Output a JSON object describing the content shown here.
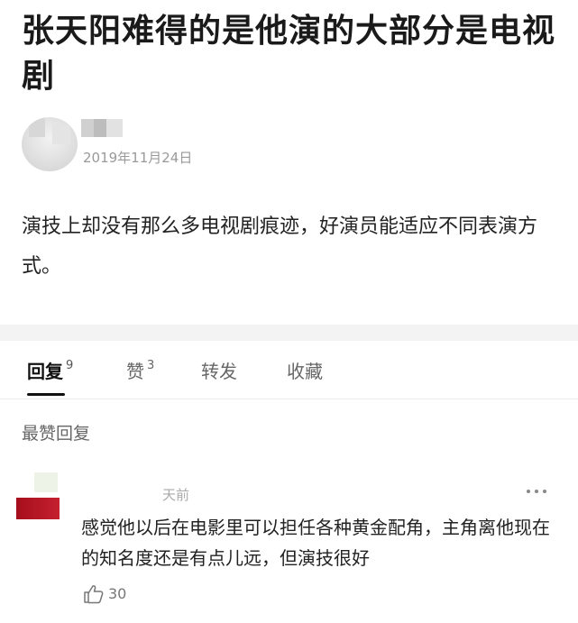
{
  "post": {
    "title": "张天阳难得的是他演的大部分是电视剧",
    "date": "2019年11月24日",
    "body": "演技上却没有那么多电视剧痕迹，好演员能适应不同表演方式。"
  },
  "tabs": [
    {
      "label": "回复",
      "count": "9"
    },
    {
      "label": "赞",
      "count": "3"
    },
    {
      "label": "转发",
      "count": ""
    },
    {
      "label": "收藏",
      "count": ""
    }
  ],
  "section": {
    "title": "最赞回复"
  },
  "comment": {
    "time": "天前",
    "text": "感觉他以后在电影里可以担任各种黄金配角，主角离他现在的知名度还是有点儿远，但演技很好",
    "likes": "30"
  },
  "icons": {
    "more": "more-dots-icon",
    "like": "thumbs-up-icon"
  },
  "colors": {
    "band": "#f3f3f3",
    "avatar_red": "#b8141f"
  }
}
